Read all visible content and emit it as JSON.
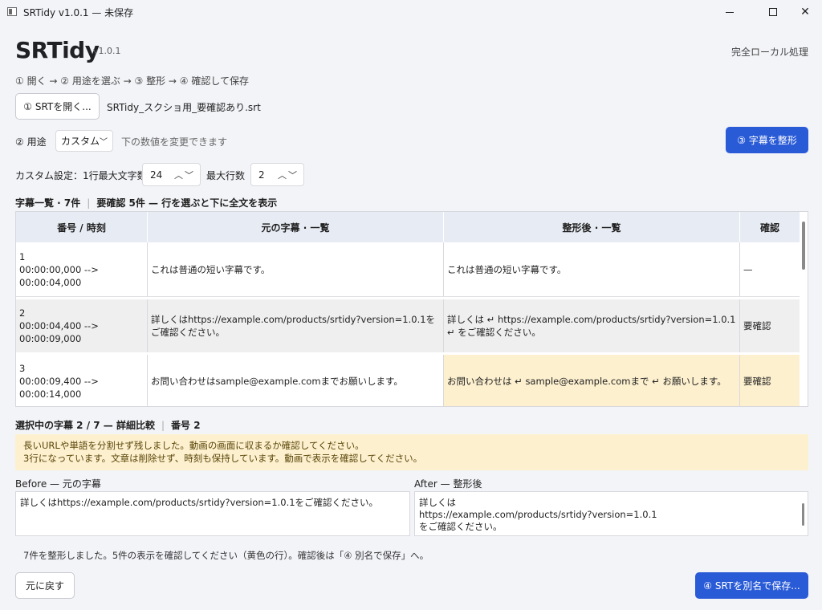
{
  "window": {
    "title": "SRTidy v1.0.1 — 未保存"
  },
  "app": {
    "name": "SRTidy",
    "version": "v1.0.1",
    "badge": "完全ローカル処理"
  },
  "steps": "① 開く → ② 用途を選ぶ → ③ 整形 → ④ 確認して保存",
  "open_button": "① SRTを開く...",
  "filename": "SRTidy_スクショ用_要確認あり.srt",
  "purpose": {
    "label": "② 用途",
    "selected": "カスタム",
    "hint": "下の数値を変更できます"
  },
  "format_button": "③ 字幕を整形",
  "custom": {
    "label": "カスタム設定：1行最大文字数",
    "max_chars": "24",
    "max_lines_label": "最大行数",
    "max_lines": "2"
  },
  "list": {
    "title": "字幕一覧 · 7件",
    "note": "要確認 5件 — 行を選ぶと下に全文を表示"
  },
  "table": {
    "headers": {
      "time": "番号 / 時刻",
      "original": "元の字幕 · 一覧",
      "formatted": "整形後 · 一覧",
      "check": "確認"
    },
    "rows": [
      {
        "num": "1",
        "time": "00:00:00,000 --> 00:00:04,000",
        "original": "これは普通の短い字幕です。",
        "formatted": "これは普通の短い字幕です。",
        "check": "—"
      },
      {
        "num": "2",
        "time": "00:00:04,400 --> 00:00:09,000",
        "original": "詳しくはhttps://example.com/products/srtidy?version=1.0.1をご確認ください。",
        "formatted": "詳しくは ↵ https://example.com/products/srtidy?version=1.0.1 ↵ をご確認ください。",
        "check": "要確認"
      },
      {
        "num": "3",
        "time": "00:00:09,400 --> 00:00:14,000",
        "original": "お問い合わせはsample@example.comまでお願いします。",
        "formatted": "お問い合わせは ↵ sample@example.comまで ↵ お願いします。",
        "check": "要確認"
      }
    ]
  },
  "detail": {
    "title": "選択中の字幕 2 / 7 — 詳細比較",
    "number": "番号 2",
    "warning1": "長いURLや単語を分割せず残しました。動画の画面に収まるか確認してください。",
    "warning2": "3行になっています。文章は削除せず、時刻も保持しています。動画で表示を確認してください。",
    "before_label": "Before — 元の字幕",
    "after_label": "After — 整形後",
    "before_text": "詳しくはhttps://example.com/products/srtidy?version=1.0.1をご確認ください。",
    "after_line1": "詳しくは",
    "after_line2": "https://example.com/products/srtidy?version=1.0.1",
    "after_line3": "をご確認ください。"
  },
  "status": "7件を整形しました。5件の表示を確認してください（黄色の行）。確認後は「④ 別名で保存」へ。",
  "undo_button": "元に戻す",
  "save_button": "④ SRTを別名で保存...",
  "colors": {
    "accent": "#2a5bd7",
    "highlight": "#fdf0cf",
    "selected_row": "#efefef"
  }
}
